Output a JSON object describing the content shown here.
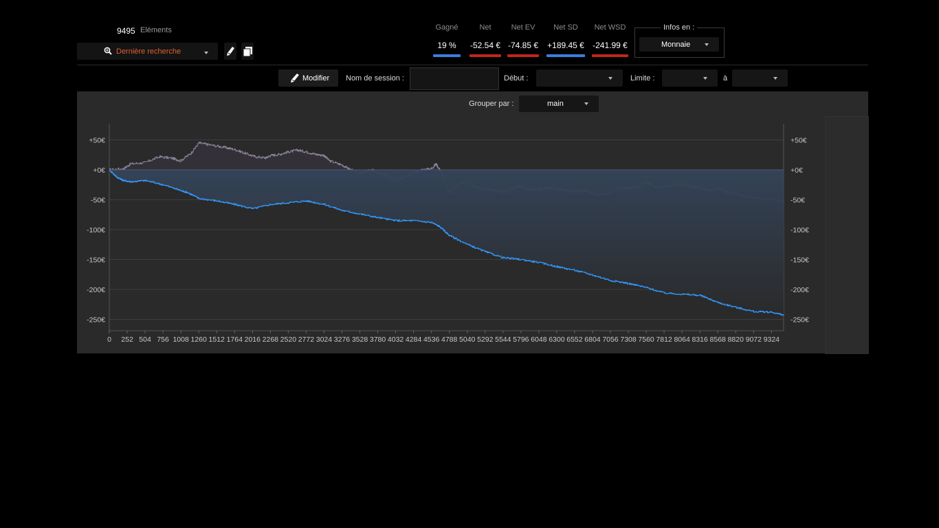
{
  "header": {
    "count": "9495",
    "count_label": "Eléments",
    "search_label": "Dernière recherche"
  },
  "stats": [
    {
      "label": "Gagné",
      "value": "19 %",
      "color": "#3a7fe0"
    },
    {
      "label": "Net",
      "value": "-52.54 €",
      "color": "#c0261c"
    },
    {
      "label": "Net EV",
      "value": "-74.85 €",
      "color": "#c0261c"
    },
    {
      "label": "Net SD",
      "value": "+189.45 €",
      "color": "#3a7fe0"
    },
    {
      "label": "Net WSD",
      "value": "-241.99 €",
      "color": "#c0261c"
    }
  ],
  "infos": {
    "legend": "Infos en :",
    "selected": "Monnaie"
  },
  "toolbar": {
    "modify_label": "Modifier",
    "session_label": "Nom de session :",
    "session_value": "",
    "start_label": "Début :",
    "start_value": "",
    "limit_label": "Limite :",
    "limit_from": "",
    "a_label": "à",
    "limit_to": ""
  },
  "group": {
    "label": "Grouper par :",
    "selected": "main"
  },
  "chart_data": {
    "type": "line",
    "x_ticks": [
      "0",
      "252",
      "504",
      "756",
      "1008",
      "1260",
      "1512",
      "1764",
      "2016",
      "2268",
      "2520",
      "2772",
      "3024",
      "3276",
      "3528",
      "3780",
      "4032",
      "4284",
      "4536",
      "4788",
      "5040",
      "5292",
      "5544",
      "5796",
      "6048",
      "6300",
      "6552",
      "6804",
      "7056",
      "7308",
      "7560",
      "7812",
      "8064",
      "8316",
      "8568",
      "8820",
      "9072",
      "9324"
    ],
    "y_ticks": [
      "+50€",
      "+0€",
      "-50€",
      "-100€",
      "-150€",
      "-200€",
      "-250€"
    ],
    "y_tick_values": [
      50,
      0,
      -50,
      -100,
      -150,
      -200,
      -250
    ],
    "xlim": [
      0,
      9495
    ],
    "ylim": [
      -270,
      75
    ],
    "grid": true,
    "series": [
      {
        "color": "#8a8499",
        "x": [
          0,
          200,
          300,
          500,
          700,
          900,
          1000,
          1150,
          1260,
          1400,
          1600,
          1764,
          1900,
          2050,
          2200,
          2268,
          2400,
          2520,
          2650,
          2772,
          2900,
          3024,
          3100,
          3276,
          3400,
          3528,
          3700,
          3780,
          3900,
          4032,
          4150,
          4284,
          4400,
          4536,
          4600,
          4680,
          4720,
          4788,
          4900,
          5040,
          5150,
          5292,
          5400,
          5544,
          5700,
          5796,
          5900,
          6048,
          6200,
          6300,
          6450,
          6552,
          6700,
          6804,
          6950,
          7056,
          7200,
          7308,
          7450,
          7560,
          7700,
          7812,
          7950,
          8064,
          8200,
          8316,
          8450,
          8568,
          8700,
          8820,
          8950,
          9072,
          9200,
          9324,
          9495
        ],
        "values": [
          0,
          2,
          10,
          12,
          22,
          19,
          15,
          28,
          45,
          42,
          38,
          34,
          28,
          22,
          20,
          24,
          26,
          30,
          33,
          30,
          26,
          24,
          15,
          8,
          0,
          -5,
          0,
          -5,
          -10,
          -18,
          -12,
          -5,
          0,
          2,
          10,
          -5,
          -20,
          -38,
          -25,
          -20,
          -30,
          -32,
          -34,
          -38,
          -30,
          -28,
          -33,
          -34,
          -30,
          -32,
          -35,
          -36,
          -35,
          -40,
          -42,
          -38,
          -30,
          -32,
          -28,
          -20,
          -30,
          -28,
          -25,
          -25,
          -28,
          -30,
          -35,
          -30,
          -38,
          -40,
          -45,
          -47,
          -48,
          -48,
          -53
        ]
      },
      {
        "color": "#3399ff",
        "x": [
          0,
          100,
          200,
          300,
          504,
          756,
          1008,
          1100,
          1260,
          1512,
          1764,
          2016,
          2268,
          2520,
          2772,
          3024,
          3276,
          3528,
          3780,
          4032,
          4284,
          4536,
          4650,
          4788,
          5040,
          5292,
          5544,
          5796,
          6048,
          6300,
          6552,
          6804,
          7056,
          7308,
          7560,
          7812,
          8064,
          8316,
          8568,
          8820,
          9072,
          9324,
          9495
        ],
        "values": [
          0,
          -12,
          -18,
          -20,
          -18,
          -25,
          -35,
          -38,
          -48,
          -52,
          -58,
          -65,
          -58,
          -55,
          -52,
          -58,
          -68,
          -74,
          -80,
          -85,
          -85,
          -88,
          -95,
          -110,
          -125,
          -137,
          -147,
          -150,
          -155,
          -162,
          -168,
          -176,
          -185,
          -190,
          -197,
          -206,
          -208,
          -210,
          -222,
          -230,
          -237,
          -238,
          -243
        ]
      }
    ]
  }
}
